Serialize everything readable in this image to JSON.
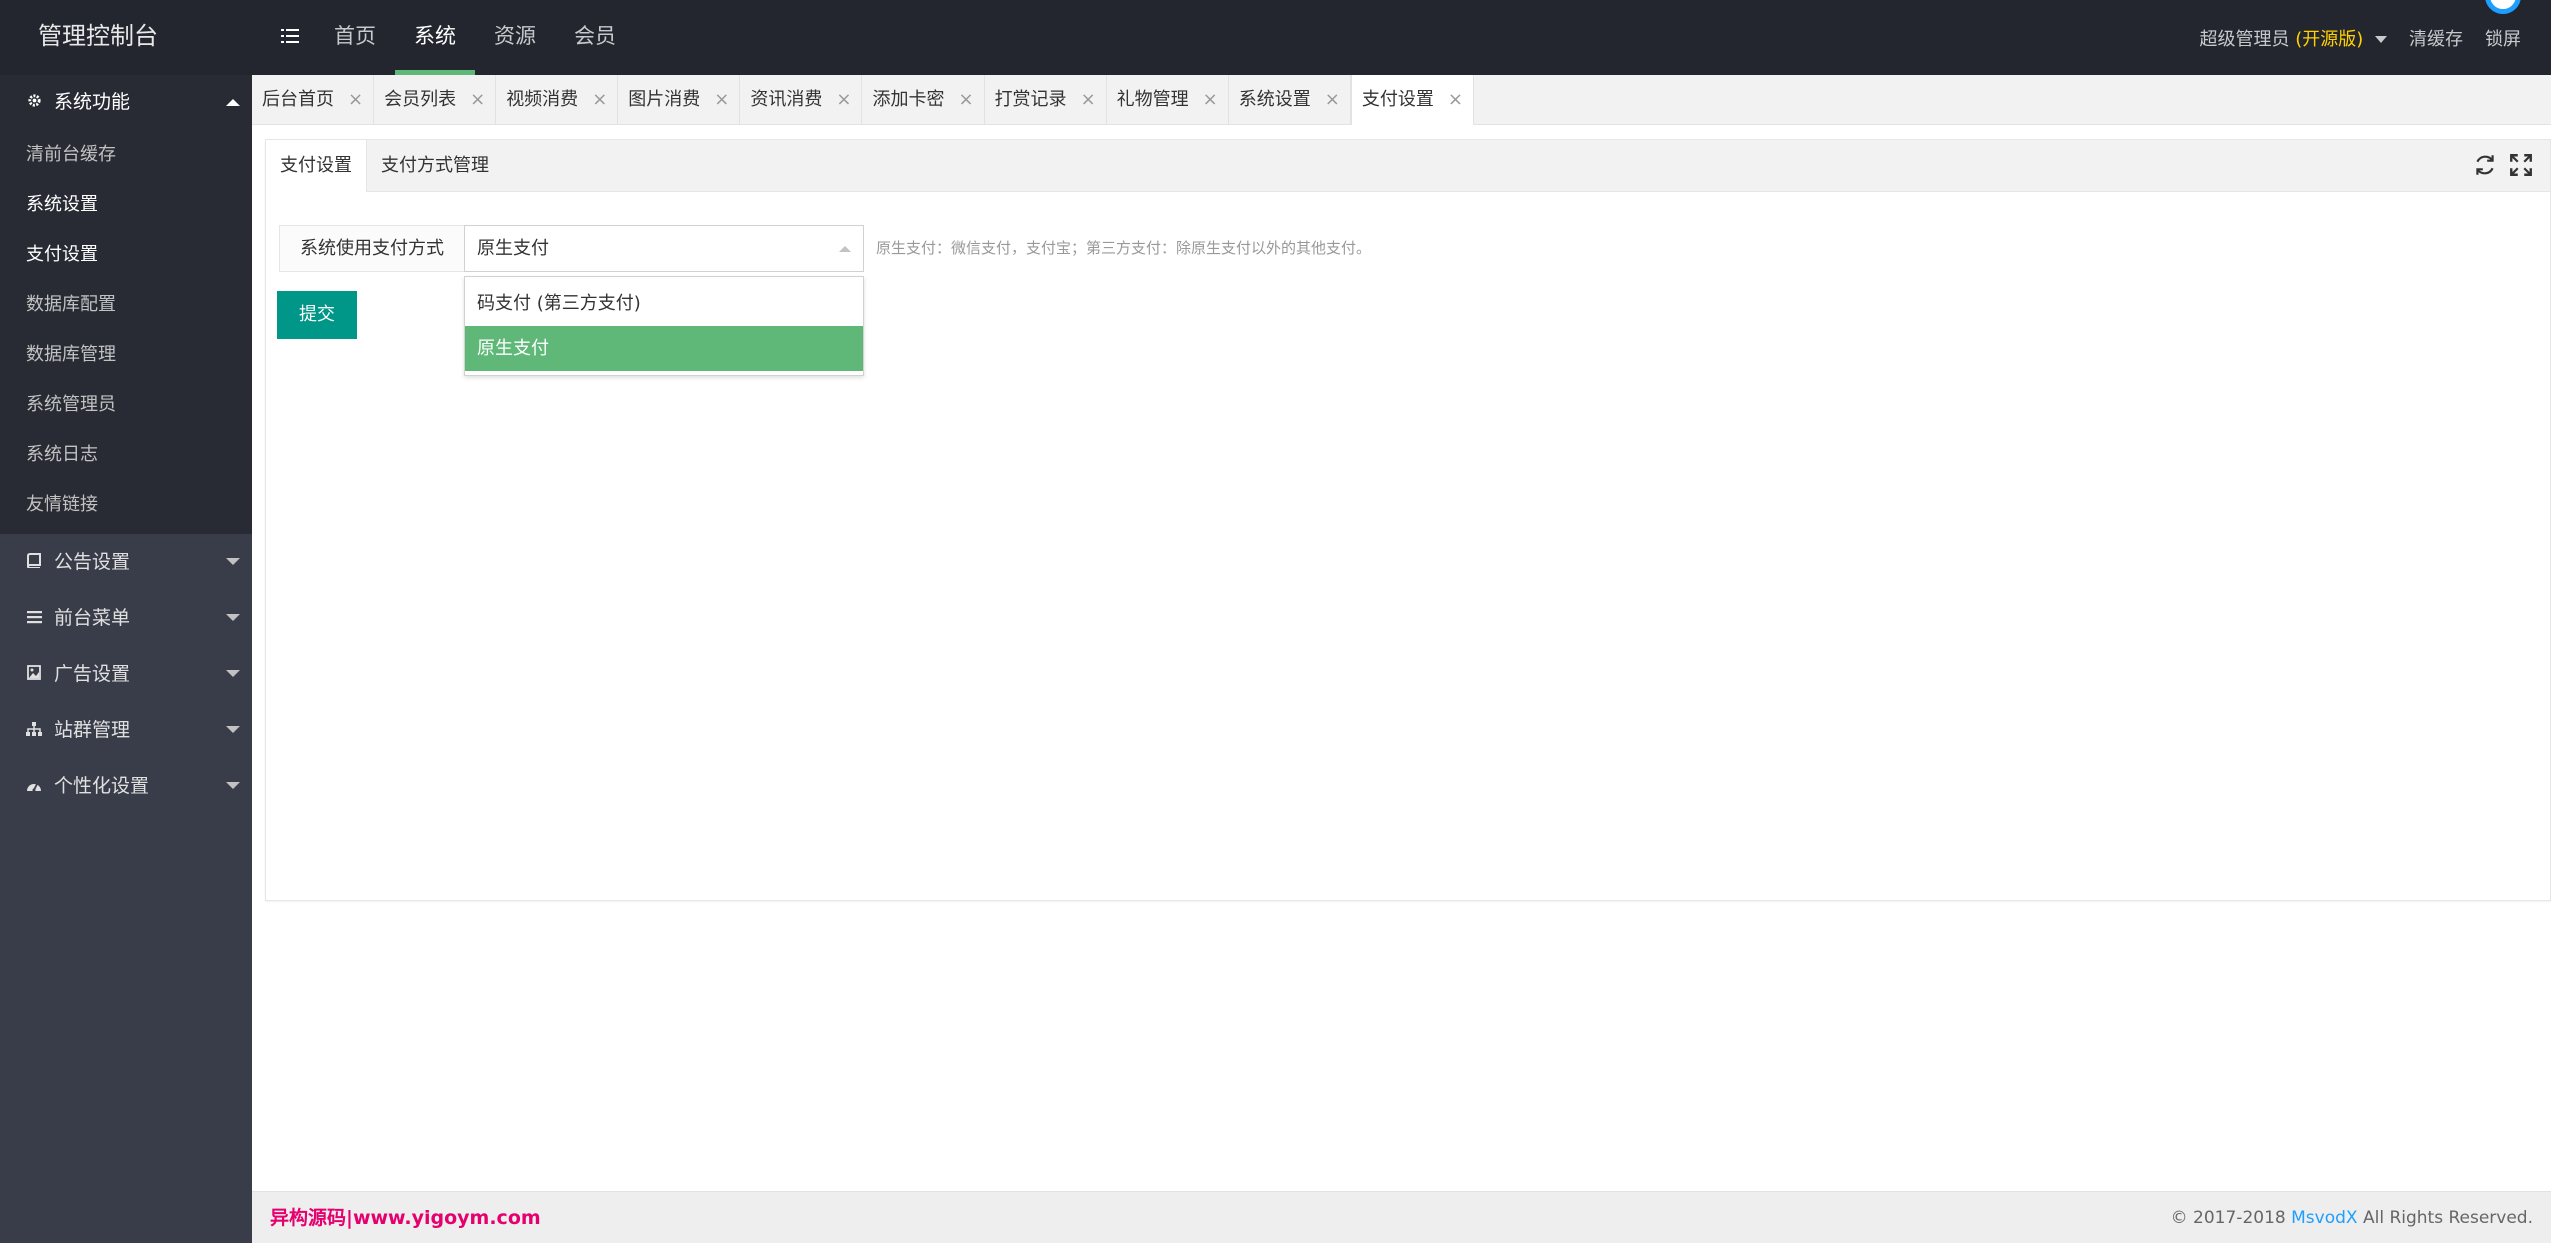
{
  "header": {
    "logo": "管理控制台",
    "nav": [
      "首页",
      "系统",
      "资源",
      "会员"
    ],
    "active_nav": "系统",
    "user": "超级管理员",
    "edition": "(开源版)",
    "clear_cache": "清缓存",
    "lock_screen": "锁屏"
  },
  "sidebar": {
    "open_group": {
      "icon": "gear-icon",
      "label": "系统功能"
    },
    "items": [
      "清前台缓存",
      "系统设置",
      "支付设置",
      "数据库配置",
      "数据库管理",
      "系统管理员",
      "系统日志",
      "友情链接"
    ],
    "groups": [
      {
        "icon": "book-icon",
        "label": "公告设置"
      },
      {
        "icon": "list-icon",
        "label": "前台菜单"
      },
      {
        "icon": "image-icon",
        "label": "广告设置"
      },
      {
        "icon": "sitemap-icon",
        "label": "站群管理"
      },
      {
        "icon": "dashboard-icon",
        "label": "个性化设置"
      }
    ]
  },
  "tabs": [
    "后台首页",
    "会员列表",
    "视频消费",
    "图片消费",
    "资讯消费",
    "添加卡密",
    "打赏记录",
    "礼物管理",
    "系统设置",
    "支付设置"
  ],
  "active_tab": "支付设置",
  "card": {
    "tabs": [
      "支付设置",
      "支付方式管理"
    ],
    "tools": [
      "refresh-icon",
      "fullscreen-icon"
    ],
    "form": {
      "label": "系统使用支付方式",
      "selected": "原生支付",
      "options": [
        "码支付 (第三方支付)",
        "原生支付"
      ],
      "help": "原生支付：微信支付，支付宝；第三方支付：除原生支付以外的其他支付。"
    },
    "submit": "提交"
  },
  "footer": {
    "left": "异构源码|www.yigoym.com",
    "copyright_prefix": "© 2017-2018 ",
    "brand": "MsvodX",
    "copyright_suffix": " All Rights Reserved."
  },
  "colors": {
    "header_bg": "#23262e",
    "sidebar_bg": "#393d49",
    "accent_green": "#5fb878",
    "button_teal": "#009688",
    "footer_brand": "#e6006e",
    "link_blue": "#1e9fff"
  }
}
